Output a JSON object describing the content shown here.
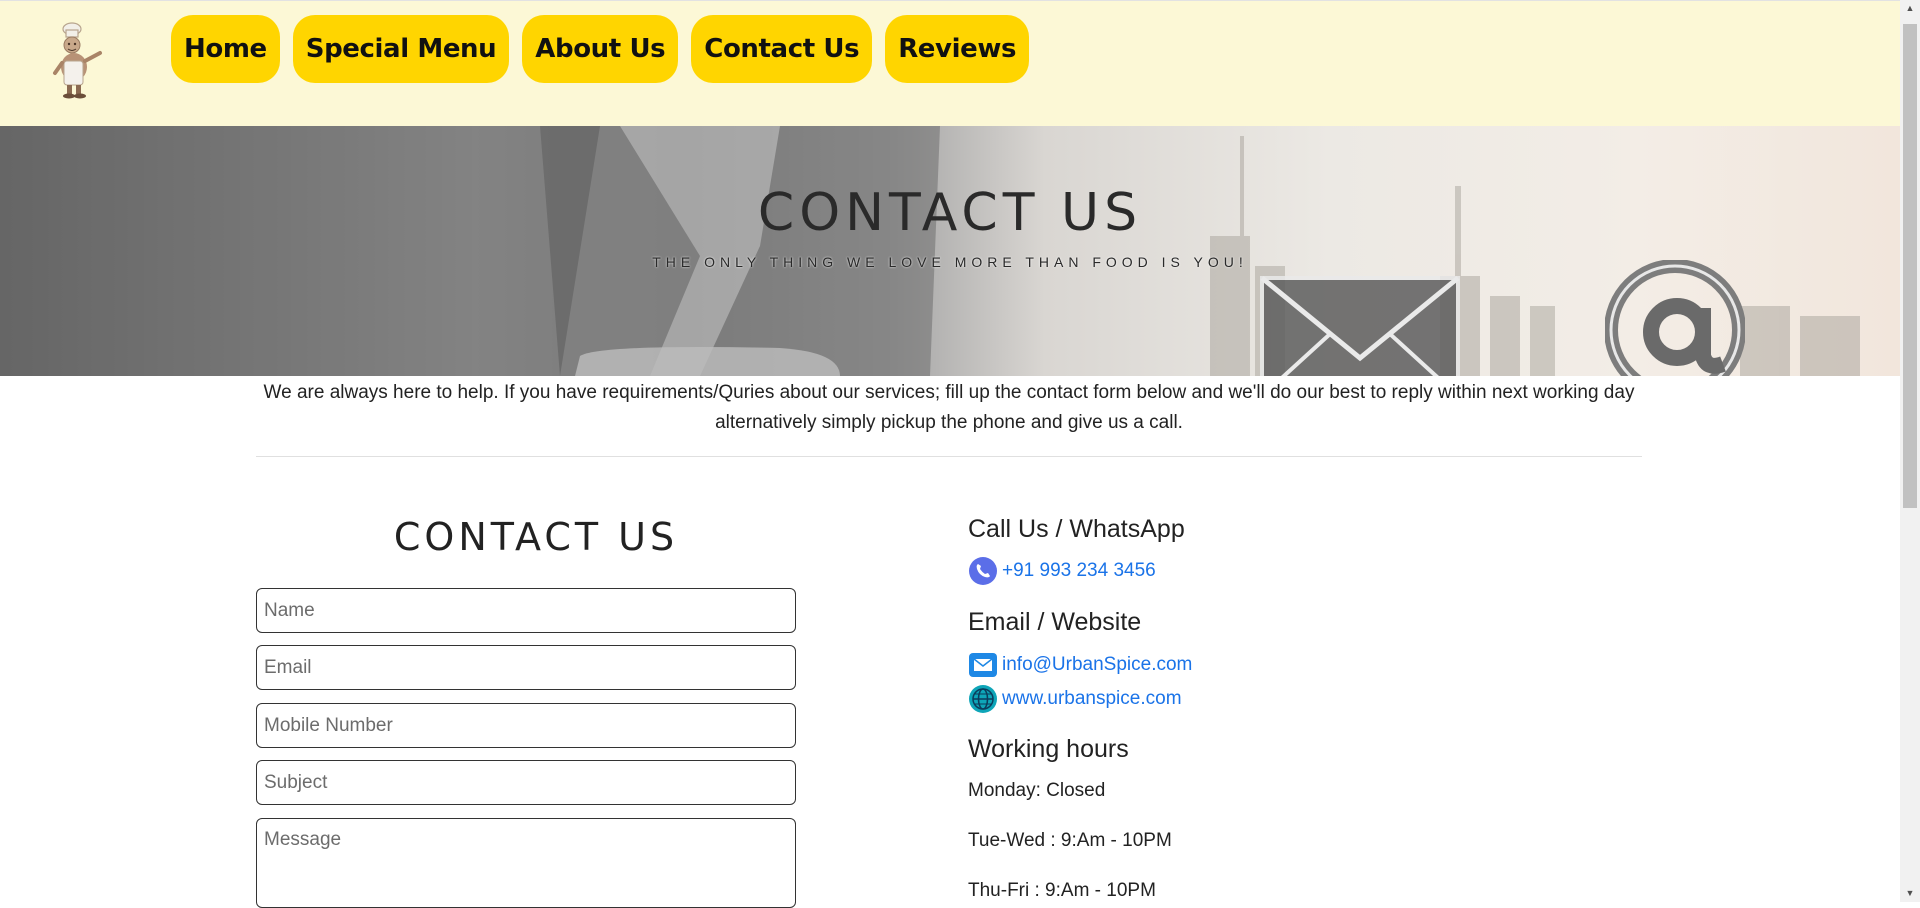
{
  "nav": {
    "items": [
      {
        "label": "Home"
      },
      {
        "label": "Special Menu"
      },
      {
        "label": "About Us"
      },
      {
        "label": "Contact Us"
      },
      {
        "label": "Reviews"
      }
    ]
  },
  "hero": {
    "title": "CONTACT US",
    "subtitle": "THE ONLY THING WE LOVE MORE THAN FOOD IS YOU!"
  },
  "intro": {
    "text": "We are always here to help. If you have requirements/Quries about our services; fill up the contact form below and we'll do our best to reply within next working day alternatively simply pickup the phone and give us a call."
  },
  "form": {
    "title": "CONTACT US",
    "name_placeholder": "Name",
    "email_placeholder": "Email",
    "mobile_placeholder": "Mobile Number",
    "subject_placeholder": "Subject",
    "message_placeholder": "Message"
  },
  "info": {
    "call_heading": "Call Us / WhatsApp",
    "phone": "+91 993 234 3456",
    "email_heading": "Email / Website",
    "email": "info@UrbanSpice.com",
    "website": "www.urbanspice.com",
    "hours_heading": "Working hours",
    "hours": [
      "Monday: Closed",
      "Tue-Wed : 9:Am - 10PM",
      "Thu-Fri : 9:Am - 10PM"
    ]
  },
  "colors": {
    "header_bg": "#fcf8d6",
    "nav_button": "#ffd500",
    "link": "#1a73e8"
  },
  "icons": {
    "logo": "chef-logo",
    "phone": "phone-icon",
    "email": "mail-icon",
    "website": "globe-icon",
    "hero_mail": "envelope-icon",
    "hero_at": "at-sign-icon"
  }
}
